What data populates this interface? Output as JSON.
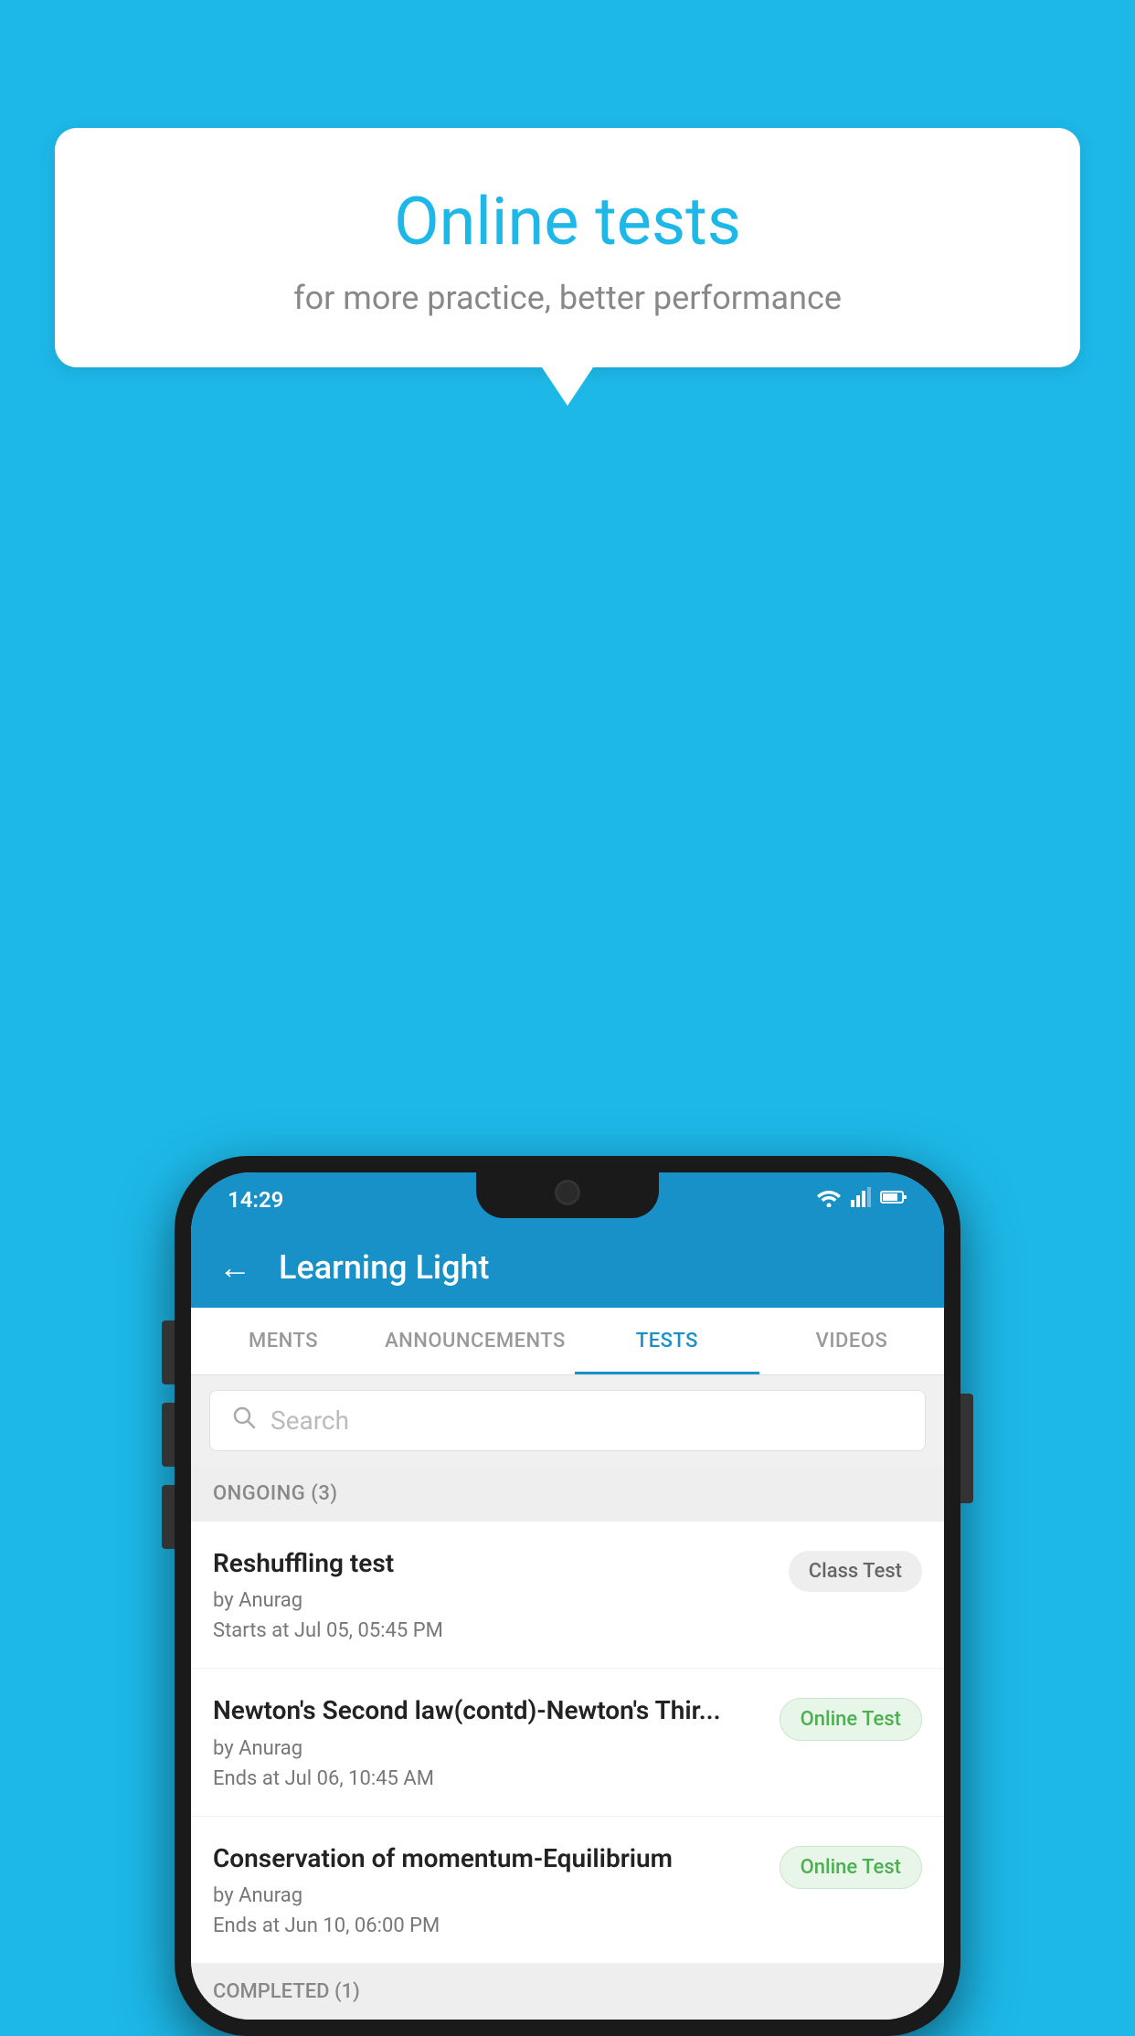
{
  "background_color": "#1DB8E8",
  "speech_bubble": {
    "title": "Online tests",
    "subtitle": "for more practice, better performance"
  },
  "phone": {
    "status_bar": {
      "time": "14:29",
      "wifi": "▾",
      "signal": "▲",
      "battery": "▮"
    },
    "app_bar": {
      "back_icon": "←",
      "title": "Learning Light"
    },
    "tabs": [
      {
        "label": "MENTS",
        "active": false
      },
      {
        "label": "ANNOUNCEMENTS",
        "active": false
      },
      {
        "label": "TESTS",
        "active": true
      },
      {
        "label": "VIDEOS",
        "active": false
      }
    ],
    "search": {
      "placeholder": "Search",
      "icon": "🔍"
    },
    "ongoing_section": {
      "label": "ONGOING (3)"
    },
    "tests": [
      {
        "title": "Reshuffling test",
        "author": "by Anurag",
        "time_label": "Starts at",
        "time": "Jul 05, 05:45 PM",
        "badge": "Class Test",
        "badge_type": "class"
      },
      {
        "title": "Newton's Second law(contd)-Newton's Thir...",
        "author": "by Anurag",
        "time_label": "Ends at",
        "time": "Jul 06, 10:45 AM",
        "badge": "Online Test",
        "badge_type": "online"
      },
      {
        "title": "Conservation of momentum-Equilibrium",
        "author": "by Anurag",
        "time_label": "Ends at",
        "time": "Jun 10, 06:00 PM",
        "badge": "Online Test",
        "badge_type": "online"
      }
    ],
    "completed_section": {
      "label": "COMPLETED (1)"
    }
  }
}
